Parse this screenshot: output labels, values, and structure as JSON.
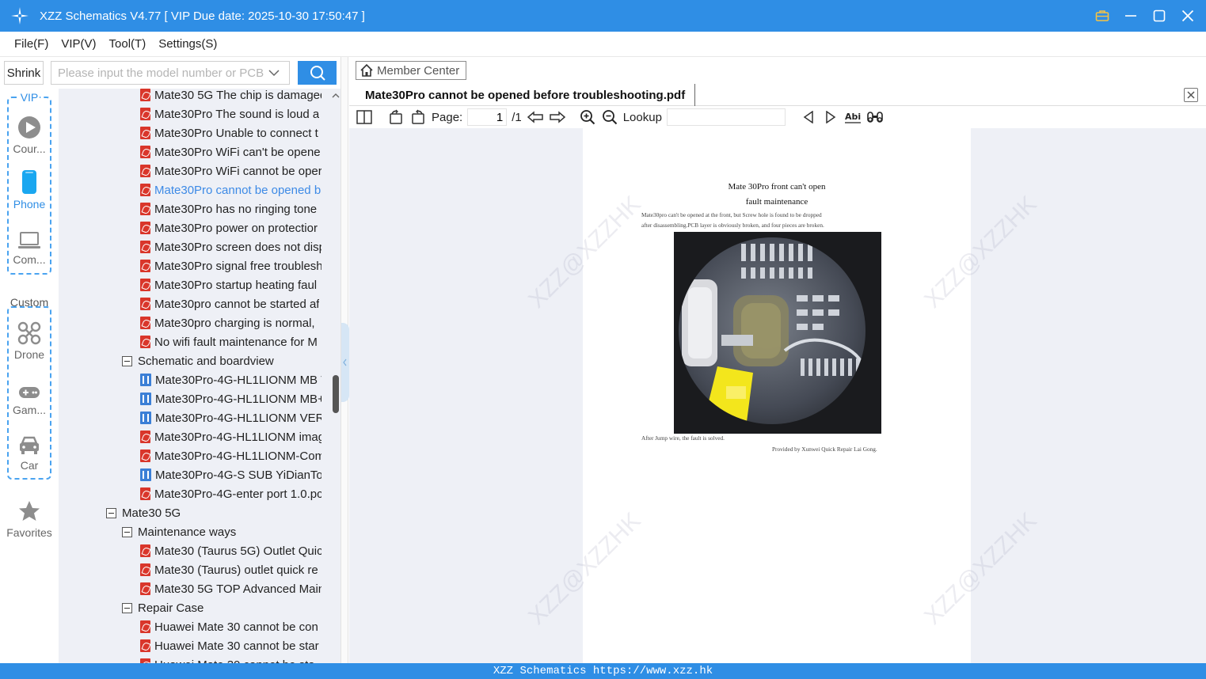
{
  "window": {
    "title": "XZZ Schematics V4.77 [ VIP Due date: 2025-10-30 17:50:47 ]"
  },
  "menu": [
    "File(F)",
    "VIP(V)",
    "Tool(T)",
    "Settings(S)"
  ],
  "search": {
    "shrink_label": "Shrink",
    "placeholder": "Please input the model number or PCB"
  },
  "sidebar": {
    "vip_label": "VIP",
    "custom_label": "Custom",
    "items": [
      {
        "label": "Cour...",
        "icon": "play-circle-icon"
      },
      {
        "label": "Phone",
        "icon": "phone-icon",
        "active": true
      },
      {
        "label": "Com...",
        "icon": "laptop-icon"
      },
      {
        "label": "Drone",
        "icon": "drone-icon"
      },
      {
        "label": "Gam...",
        "icon": "gamepad-icon"
      },
      {
        "label": "Car",
        "icon": "car-icon"
      },
      {
        "label": "Favorites",
        "icon": "star-icon"
      }
    ]
  },
  "tree": [
    {
      "type": "pdf",
      "level": 2,
      "label": "Mate30 5G The chip is damaged"
    },
    {
      "type": "pdf",
      "level": 2,
      "label": "Mate30Pro The sound is loud a"
    },
    {
      "type": "pdf",
      "level": 2,
      "label": "Mate30Pro Unable to connect t"
    },
    {
      "type": "pdf",
      "level": 2,
      "label": "Mate30Pro WiFi can't be opene"
    },
    {
      "type": "pdf",
      "level": 2,
      "label": "Mate30Pro WiFi cannot be oper"
    },
    {
      "type": "pdf",
      "level": 2,
      "label": "Mate30Pro cannot be opened b",
      "selected": true
    },
    {
      "type": "pdf",
      "level": 2,
      "label": "Mate30Pro has no ringing tone"
    },
    {
      "type": "pdf",
      "level": 2,
      "label": "Mate30Pro power on protectior"
    },
    {
      "type": "pdf",
      "level": 2,
      "label": "Mate30Pro screen does not disp"
    },
    {
      "type": "pdf",
      "level": 2,
      "label": "Mate30Pro signal free troublesh"
    },
    {
      "type": "pdf",
      "level": 2,
      "label": "Mate30Pro startup heating faul"
    },
    {
      "type": "pdf",
      "level": 2,
      "label": "Mate30pro cannot be started af"
    },
    {
      "type": "pdf",
      "level": 2,
      "label": "Mate30pro charging is normal,"
    },
    {
      "type": "pdf",
      "level": 2,
      "label": "No wifi fault maintenance for M"
    },
    {
      "type": "folder",
      "level": 1,
      "label": "Schematic and boardview"
    },
    {
      "type": "sch",
      "level": 2,
      "label": "Mate30Pro-4G-HL1LIONM MB V"
    },
    {
      "type": "sch",
      "level": 2,
      "label": "Mate30Pro-4G-HL1LIONM MB+"
    },
    {
      "type": "sch",
      "level": 2,
      "label": "Mate30Pro-4G-HL1LIONM VER."
    },
    {
      "type": "pdf",
      "level": 2,
      "label": "Mate30Pro-4G-HL1LIONM imag"
    },
    {
      "type": "pdf",
      "level": 2,
      "label": "Mate30Pro-4G-HL1LIONM-Com"
    },
    {
      "type": "sch",
      "level": 2,
      "label": "Mate30Pro-4G-S SUB YiDianTor"
    },
    {
      "type": "pdf",
      "level": 2,
      "label": "Mate30Pro-4G-enter port 1.0.pc"
    },
    {
      "type": "folder",
      "level": 0,
      "label": "Mate30 5G"
    },
    {
      "type": "folder",
      "level": 1,
      "label": "Maintenance ways"
    },
    {
      "type": "pdf",
      "level": 2,
      "label": "Mate30 (Taurus 5G) Outlet Quic"
    },
    {
      "type": "pdf",
      "level": 2,
      "label": "Mate30 (Taurus) outlet quick re"
    },
    {
      "type": "pdf",
      "level": 2,
      "label": "Mate30 5G TOP Advanced Main"
    },
    {
      "type": "folder",
      "level": 1,
      "label": "Repair Case"
    },
    {
      "type": "pdf",
      "level": 2,
      "label": "Huawei Mate 30 cannot be con"
    },
    {
      "type": "pdf",
      "level": 2,
      "label": "Huawei Mate 30 cannot be star"
    },
    {
      "type": "pdf",
      "level": 2,
      "label": "Huawei Mate 30 cannot be sta"
    }
  ],
  "viewer": {
    "member_center_label": "Member Center",
    "doc_tab_title": "Mate30Pro cannot be opened before troubleshooting.pdf",
    "toolbar": {
      "page_label": "Page:",
      "page_value": "1",
      "page_total": "/1",
      "lookup_label": "Lookup",
      "lookup_value": ""
    },
    "pdf": {
      "title_line1": "Mate 30Pro front can't open",
      "title_line2": "fault maintenance",
      "desc_line1": "Mate30pro can't be opened at the front, but Screw hole is found to be dropped",
      "desc_line2": "after disassembling.PCB layer is obviously broken, and four pieces are broken.",
      "caption": "After Jump wire, the fault is solved.",
      "credit": "Provided by Xunwei Quick Repair Lai Gong.",
      "watermark": "XZZ@XZZHK"
    }
  },
  "status": {
    "text": "XZZ Schematics https://www.xzz.hk"
  },
  "colors": {
    "accent": "#2f8ee5",
    "selected_text": "#3d8ae6",
    "pdf_icon": "#d9362b",
    "schematic_icon": "#3b7fd6",
    "tree_bg": "#eef0f6"
  }
}
